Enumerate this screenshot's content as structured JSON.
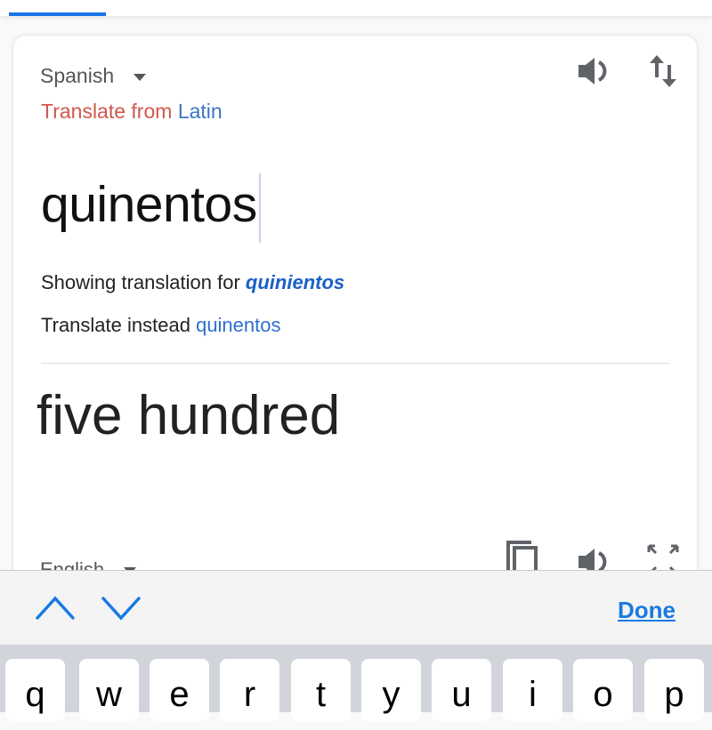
{
  "source_panel": {
    "language": "Spanish",
    "translate_from_prefix": "Translate from",
    "translate_from_language": "Latin",
    "input_text": "quinentos",
    "showing_prefix": "Showing translation for",
    "showing_term": "quinientos",
    "instead_prefix": "Translate instead",
    "instead_term": "quinentos"
  },
  "target_panel": {
    "translation": "five hundred",
    "language": "English"
  },
  "toolbar": {
    "done_label": "Done"
  },
  "keyboard": {
    "keys": [
      "q",
      "w",
      "e",
      "r",
      "t",
      "y",
      "u",
      "i",
      "o",
      "p"
    ]
  },
  "colors": {
    "accent": "#1a73e8",
    "detected": "#d2574c",
    "link": "#2f6fd0"
  }
}
